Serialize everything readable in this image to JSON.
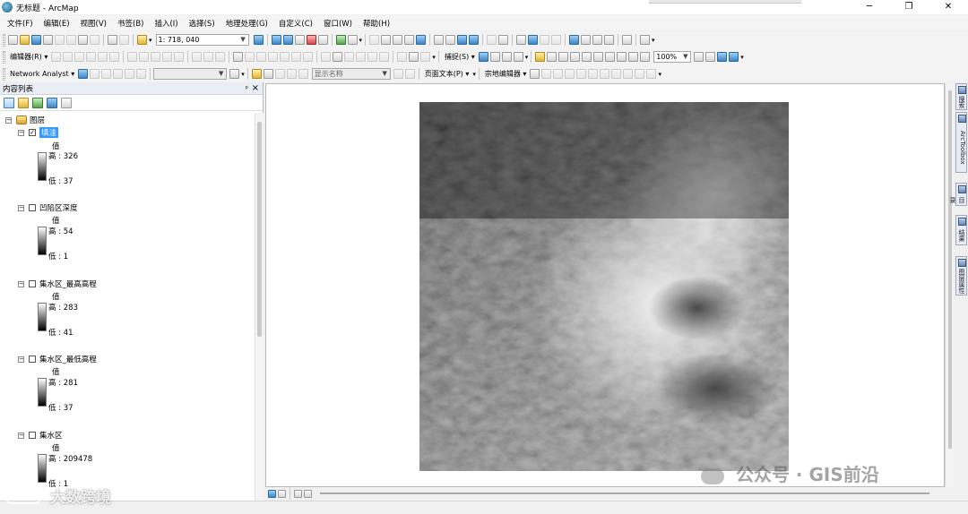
{
  "window": {
    "title": "无标题 - ArcMap",
    "controls": [
      "─",
      "❐",
      "✕"
    ]
  },
  "menu": [
    "文件(F)",
    "编辑(E)",
    "视图(V)",
    "书签(B)",
    "插入(I)",
    "选择(S)",
    "地理处理(G)",
    "自定义(C)",
    "窗口(W)",
    "帮助(H)"
  ],
  "toolbars": {
    "scale": "1: 718, 040",
    "editor_label": "编辑器(R) ▾",
    "network_analyst_label": "Network Analyst ▾",
    "display_name_combo": "显示名称",
    "snapping_label": "捕捉(S) ▾",
    "zoom_percent": "100%",
    "page_text_label": "页面文本(P) ▾",
    "topology_editor_label": "宗地编辑器 ▾"
  },
  "toc": {
    "header": "内容列表",
    "pin": "ᵖ",
    "close": "×",
    "root_label": "图层",
    "value_label": "值",
    "layers": [
      {
        "name": "填洼",
        "checked": true,
        "selected": true,
        "high": "高 : 326",
        "low": "低 : 37"
      },
      {
        "name": "凹陷区深度",
        "checked": false,
        "selected": false,
        "high": "高 : 54",
        "low": "低 : 1"
      },
      {
        "name": "集水区_最高高程",
        "checked": false,
        "selected": false,
        "high": "高 : 283",
        "low": "低 : 41"
      },
      {
        "name": "集水区_最低高程",
        "checked": false,
        "selected": false,
        "high": "高 : 281",
        "low": "低 : 37"
      },
      {
        "name": "集水区",
        "checked": false,
        "selected": false,
        "high": "高 : 209478",
        "low": "低 : 1"
      }
    ]
  },
  "side_tabs": [
    "搜索",
    "ArcToolbox",
    "目录",
    "结果",
    "图层属性"
  ],
  "watermarks": {
    "right": "公众号 · GIS前沿",
    "left": "大数跨境"
  }
}
